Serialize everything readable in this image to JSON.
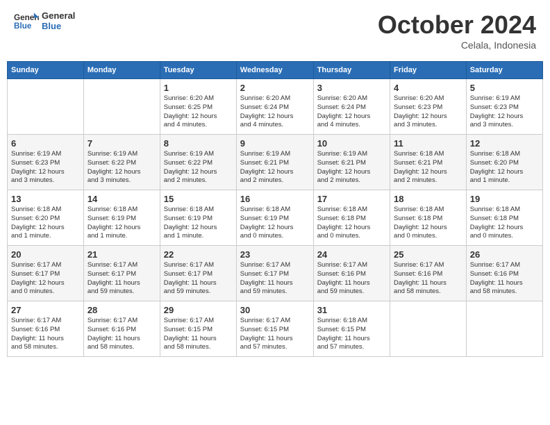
{
  "header": {
    "logo_general": "General",
    "logo_blue": "Blue",
    "month": "October 2024",
    "location": "Celala, Indonesia"
  },
  "weekdays": [
    "Sunday",
    "Monday",
    "Tuesday",
    "Wednesday",
    "Thursday",
    "Friday",
    "Saturday"
  ],
  "weeks": [
    [
      {
        "day": "",
        "info": ""
      },
      {
        "day": "",
        "info": ""
      },
      {
        "day": "1",
        "info": "Sunrise: 6:20 AM\nSunset: 6:25 PM\nDaylight: 12 hours\nand 4 minutes."
      },
      {
        "day": "2",
        "info": "Sunrise: 6:20 AM\nSunset: 6:24 PM\nDaylight: 12 hours\nand 4 minutes."
      },
      {
        "day": "3",
        "info": "Sunrise: 6:20 AM\nSunset: 6:24 PM\nDaylight: 12 hours\nand 4 minutes."
      },
      {
        "day": "4",
        "info": "Sunrise: 6:20 AM\nSunset: 6:23 PM\nDaylight: 12 hours\nand 3 minutes."
      },
      {
        "day": "5",
        "info": "Sunrise: 6:19 AM\nSunset: 6:23 PM\nDaylight: 12 hours\nand 3 minutes."
      }
    ],
    [
      {
        "day": "6",
        "info": "Sunrise: 6:19 AM\nSunset: 6:23 PM\nDaylight: 12 hours\nand 3 minutes."
      },
      {
        "day": "7",
        "info": "Sunrise: 6:19 AM\nSunset: 6:22 PM\nDaylight: 12 hours\nand 3 minutes."
      },
      {
        "day": "8",
        "info": "Sunrise: 6:19 AM\nSunset: 6:22 PM\nDaylight: 12 hours\nand 2 minutes."
      },
      {
        "day": "9",
        "info": "Sunrise: 6:19 AM\nSunset: 6:21 PM\nDaylight: 12 hours\nand 2 minutes."
      },
      {
        "day": "10",
        "info": "Sunrise: 6:19 AM\nSunset: 6:21 PM\nDaylight: 12 hours\nand 2 minutes."
      },
      {
        "day": "11",
        "info": "Sunrise: 6:18 AM\nSunset: 6:21 PM\nDaylight: 12 hours\nand 2 minutes."
      },
      {
        "day": "12",
        "info": "Sunrise: 6:18 AM\nSunset: 6:20 PM\nDaylight: 12 hours\nand 1 minute."
      }
    ],
    [
      {
        "day": "13",
        "info": "Sunrise: 6:18 AM\nSunset: 6:20 PM\nDaylight: 12 hours\nand 1 minute."
      },
      {
        "day": "14",
        "info": "Sunrise: 6:18 AM\nSunset: 6:19 PM\nDaylight: 12 hours\nand 1 minute."
      },
      {
        "day": "15",
        "info": "Sunrise: 6:18 AM\nSunset: 6:19 PM\nDaylight: 12 hours\nand 1 minute."
      },
      {
        "day": "16",
        "info": "Sunrise: 6:18 AM\nSunset: 6:19 PM\nDaylight: 12 hours\nand 0 minutes."
      },
      {
        "day": "17",
        "info": "Sunrise: 6:18 AM\nSunset: 6:18 PM\nDaylight: 12 hours\nand 0 minutes."
      },
      {
        "day": "18",
        "info": "Sunrise: 6:18 AM\nSunset: 6:18 PM\nDaylight: 12 hours\nand 0 minutes."
      },
      {
        "day": "19",
        "info": "Sunrise: 6:18 AM\nSunset: 6:18 PM\nDaylight: 12 hours\nand 0 minutes."
      }
    ],
    [
      {
        "day": "20",
        "info": "Sunrise: 6:17 AM\nSunset: 6:17 PM\nDaylight: 12 hours\nand 0 minutes."
      },
      {
        "day": "21",
        "info": "Sunrise: 6:17 AM\nSunset: 6:17 PM\nDaylight: 11 hours\nand 59 minutes."
      },
      {
        "day": "22",
        "info": "Sunrise: 6:17 AM\nSunset: 6:17 PM\nDaylight: 11 hours\nand 59 minutes."
      },
      {
        "day": "23",
        "info": "Sunrise: 6:17 AM\nSunset: 6:17 PM\nDaylight: 11 hours\nand 59 minutes."
      },
      {
        "day": "24",
        "info": "Sunrise: 6:17 AM\nSunset: 6:16 PM\nDaylight: 11 hours\nand 59 minutes."
      },
      {
        "day": "25",
        "info": "Sunrise: 6:17 AM\nSunset: 6:16 PM\nDaylight: 11 hours\nand 58 minutes."
      },
      {
        "day": "26",
        "info": "Sunrise: 6:17 AM\nSunset: 6:16 PM\nDaylight: 11 hours\nand 58 minutes."
      }
    ],
    [
      {
        "day": "27",
        "info": "Sunrise: 6:17 AM\nSunset: 6:16 PM\nDaylight: 11 hours\nand 58 minutes."
      },
      {
        "day": "28",
        "info": "Sunrise: 6:17 AM\nSunset: 6:16 PM\nDaylight: 11 hours\nand 58 minutes."
      },
      {
        "day": "29",
        "info": "Sunrise: 6:17 AM\nSunset: 6:15 PM\nDaylight: 11 hours\nand 58 minutes."
      },
      {
        "day": "30",
        "info": "Sunrise: 6:17 AM\nSunset: 6:15 PM\nDaylight: 11 hours\nand 57 minutes."
      },
      {
        "day": "31",
        "info": "Sunrise: 6:18 AM\nSunset: 6:15 PM\nDaylight: 11 hours\nand 57 minutes."
      },
      {
        "day": "",
        "info": ""
      },
      {
        "day": "",
        "info": ""
      }
    ]
  ]
}
